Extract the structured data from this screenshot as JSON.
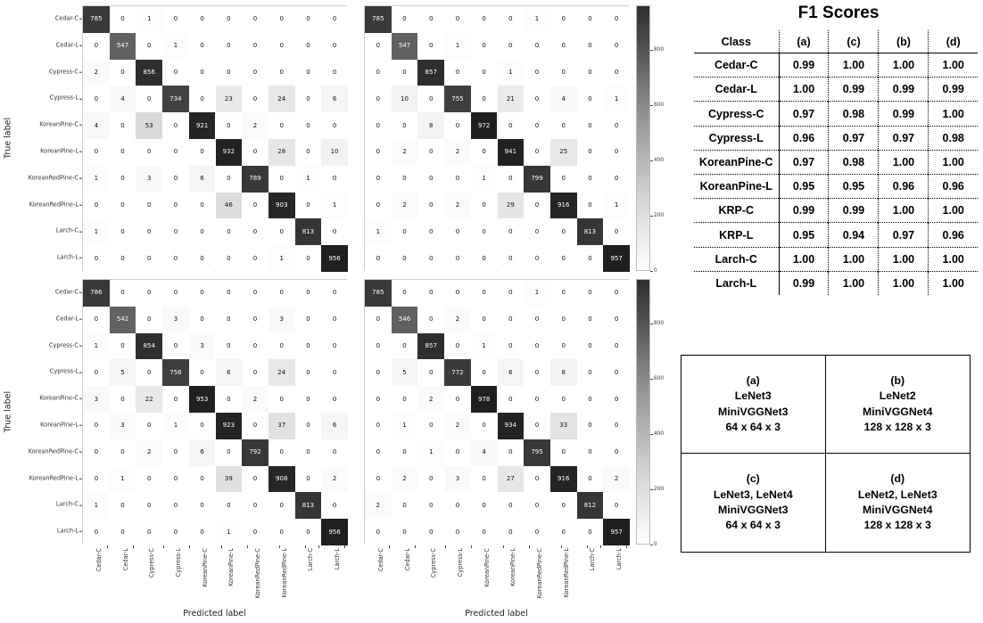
{
  "classes": [
    "Cedar-C",
    "Cedar-L",
    "Cypress-C",
    "Cypress-L",
    "KoreanPine-C",
    "KoreanPine-L",
    "KoreanRedPine-C",
    "KoreanRedPine-L",
    "Larch-C",
    "Larch-L"
  ],
  "axis": {
    "ylabel": "True label",
    "xlabel": "Predicted label"
  },
  "colorbar": {
    "ticks": [
      "800",
      "600",
      "400",
      "200",
      "0"
    ],
    "values": [
      800,
      600,
      400,
      200,
      0
    ],
    "vmin": 0,
    "vmax": 960,
    "cmap": "Greys"
  },
  "chart_data": [
    {
      "type": "heatmap",
      "panel": "a",
      "title": "",
      "xlabel": "Predicted label",
      "ylabel": "True label",
      "categories": [
        "Cedar-C",
        "Cedar-L",
        "Cypress-C",
        "Cypress-L",
        "KoreanPine-C",
        "KoreanPine-L",
        "KoreanRedPine-C",
        "KoreanRedPine-L",
        "Larch-C",
        "Larch-L"
      ],
      "values": [
        [
          785,
          0,
          1,
          0,
          0,
          0,
          0,
          0,
          0,
          0
        ],
        [
          0,
          547,
          0,
          1,
          0,
          0,
          0,
          0,
          0,
          0
        ],
        [
          2,
          0,
          856,
          0,
          0,
          0,
          0,
          0,
          0,
          0
        ],
        [
          0,
          4,
          0,
          734,
          0,
          23,
          0,
          24,
          0,
          6
        ],
        [
          4,
          0,
          53,
          0,
          921,
          0,
          2,
          0,
          0,
          0
        ],
        [
          0,
          0,
          0,
          0,
          0,
          932,
          0,
          28,
          0,
          10
        ],
        [
          1,
          0,
          3,
          0,
          6,
          0,
          789,
          0,
          1,
          0
        ],
        [
          0,
          0,
          0,
          0,
          0,
          46,
          0,
          903,
          0,
          1
        ],
        [
          1,
          0,
          0,
          0,
          0,
          0,
          0,
          0,
          813,
          0
        ],
        [
          0,
          0,
          0,
          0,
          0,
          0,
          0,
          1,
          0,
          956
        ]
      ]
    },
    {
      "type": "heatmap",
      "panel": "b",
      "title": "",
      "xlabel": "Predicted label",
      "ylabel": "True label",
      "categories": [
        "Cedar-C",
        "Cedar-L",
        "Cypress-C",
        "Cypress-L",
        "KoreanPine-C",
        "KoreanPine-L",
        "KoreanRedPine-C",
        "KoreanRedPine-L",
        "Larch-C",
        "Larch-L"
      ],
      "values": [
        [
          785,
          0,
          0,
          0,
          0,
          0,
          1,
          0,
          0,
          0
        ],
        [
          0,
          547,
          0,
          1,
          0,
          0,
          0,
          0,
          0,
          0
        ],
        [
          0,
          0,
          857,
          0,
          0,
          1,
          0,
          0,
          0,
          0
        ],
        [
          0,
          10,
          0,
          755,
          0,
          21,
          0,
          4,
          0,
          1
        ],
        [
          0,
          0,
          8,
          0,
          972,
          0,
          0,
          0,
          0,
          0
        ],
        [
          0,
          2,
          0,
          2,
          0,
          941,
          0,
          25,
          0,
          0
        ],
        [
          0,
          0,
          0,
          0,
          1,
          0,
          799,
          0,
          0,
          0
        ],
        [
          0,
          2,
          0,
          2,
          0,
          29,
          0,
          916,
          0,
          1
        ],
        [
          1,
          0,
          0,
          0,
          0,
          0,
          0,
          0,
          813,
          0
        ],
        [
          0,
          0,
          0,
          0,
          0,
          0,
          0,
          0,
          0,
          957
        ]
      ]
    },
    {
      "type": "heatmap",
      "panel": "c",
      "title": "",
      "xlabel": "Predicted label",
      "ylabel": "True label",
      "categories": [
        "Cedar-C",
        "Cedar-L",
        "Cypress-C",
        "Cypress-L",
        "KoreanPine-C",
        "KoreanPine-L",
        "KoreanRedPine-C",
        "KoreanRedPine-L",
        "Larch-C",
        "Larch-L"
      ],
      "values": [
        [
          786,
          0,
          0,
          0,
          0,
          0,
          0,
          0,
          0,
          0
        ],
        [
          0,
          542,
          0,
          3,
          0,
          0,
          0,
          3,
          0,
          0
        ],
        [
          1,
          0,
          854,
          0,
          3,
          0,
          0,
          0,
          0,
          0
        ],
        [
          0,
          5,
          0,
          756,
          0,
          6,
          0,
          24,
          0,
          0
        ],
        [
          3,
          0,
          22,
          0,
          953,
          0,
          2,
          0,
          0,
          0
        ],
        [
          0,
          3,
          0,
          1,
          0,
          923,
          0,
          37,
          0,
          6
        ],
        [
          0,
          0,
          2,
          0,
          6,
          0,
          792,
          0,
          0,
          0
        ],
        [
          0,
          1,
          0,
          0,
          0,
          39,
          0,
          908,
          0,
          2
        ],
        [
          1,
          0,
          0,
          0,
          0,
          0,
          0,
          0,
          813,
          0
        ],
        [
          0,
          0,
          0,
          0,
          0,
          1,
          0,
          0,
          0,
          956
        ]
      ]
    },
    {
      "type": "heatmap",
      "panel": "d",
      "title": "",
      "xlabel": "Predicted label",
      "ylabel": "True label",
      "categories": [
        "Cedar-C",
        "Cedar-L",
        "Cypress-C",
        "Cypress-L",
        "KoreanPine-C",
        "KoreanPine-L",
        "KoreanRedPine-C",
        "KoreanRedPine-L",
        "Larch-C",
        "Larch-L"
      ],
      "values": [
        [
          785,
          0,
          0,
          0,
          0,
          0,
          1,
          0,
          0,
          0
        ],
        [
          0,
          546,
          0,
          2,
          0,
          0,
          0,
          0,
          0,
          0
        ],
        [
          0,
          0,
          857,
          0,
          1,
          0,
          0,
          0,
          0,
          0
        ],
        [
          0,
          5,
          0,
          772,
          0,
          6,
          0,
          8,
          0,
          0
        ],
        [
          0,
          0,
          2,
          0,
          978,
          0,
          0,
          0,
          0,
          0
        ],
        [
          0,
          1,
          0,
          2,
          0,
          934,
          0,
          33,
          0,
          0
        ],
        [
          0,
          0,
          1,
          0,
          4,
          0,
          795,
          0,
          0,
          0
        ],
        [
          0,
          2,
          0,
          3,
          0,
          27,
          0,
          916,
          0,
          2
        ],
        [
          2,
          0,
          0,
          0,
          0,
          0,
          0,
          0,
          812,
          0
        ],
        [
          0,
          0,
          0,
          0,
          0,
          0,
          0,
          0,
          0,
          957
        ]
      ]
    }
  ],
  "f1": {
    "title": "F1 Scores",
    "headers": [
      "Class",
      "(a)",
      "(c)",
      "(b)",
      "(d)"
    ],
    "rows": [
      {
        "cls": "Cedar-C",
        "a": "0.99",
        "c": "1.00",
        "b": "1.00",
        "d": "1.00"
      },
      {
        "cls": "Cedar-L",
        "a": "1.00",
        "c": "0.99",
        "b": "0.99",
        "d": "0.99"
      },
      {
        "cls": "Cypress-C",
        "a": "0.97",
        "c": "0.98",
        "b": "0.99",
        "d": "1.00"
      },
      {
        "cls": "Cypress-L",
        "a": "0.96",
        "c": "0.97",
        "b": "0.97",
        "d": "0.98"
      },
      {
        "cls": "KoreanPine-C",
        "a": "0.97",
        "c": "0.98",
        "b": "1.00",
        "d": "1.00"
      },
      {
        "cls": "KoreanPine-L",
        "a": "0.95",
        "c": "0.95",
        "b": "0.96",
        "d": "0.96"
      },
      {
        "cls": "KRP-C",
        "a": "0.99",
        "c": "0.99",
        "b": "1.00",
        "d": "1.00"
      },
      {
        "cls": "KRP-L",
        "a": "0.95",
        "c": "0.94",
        "b": "0.97",
        "d": "0.96"
      },
      {
        "cls": "Larch-C",
        "a": "1.00",
        "c": "1.00",
        "b": "1.00",
        "d": "1.00"
      },
      {
        "cls": "Larch-L",
        "a": "0.99",
        "c": "1.00",
        "b": "1.00",
        "d": "1.00"
      }
    ]
  },
  "legend": {
    "cells": [
      {
        "key": "(a)",
        "lines": [
          "LeNet3",
          "MiniVGGNet3",
          "64 x 64 x 3"
        ]
      },
      {
        "key": "(b)",
        "lines": [
          "LeNet2",
          "MiniVGGNet4",
          "128 x 128 x 3"
        ]
      },
      {
        "key": "(c)",
        "lines": [
          "LeNet3, LeNet4",
          "MiniVGGNet3",
          "64 x 64 x 3"
        ]
      },
      {
        "key": "(d)",
        "lines": [
          "LeNet2, LeNet3",
          "MiniVGGNet4",
          "128 x 128 x 3"
        ]
      }
    ]
  }
}
